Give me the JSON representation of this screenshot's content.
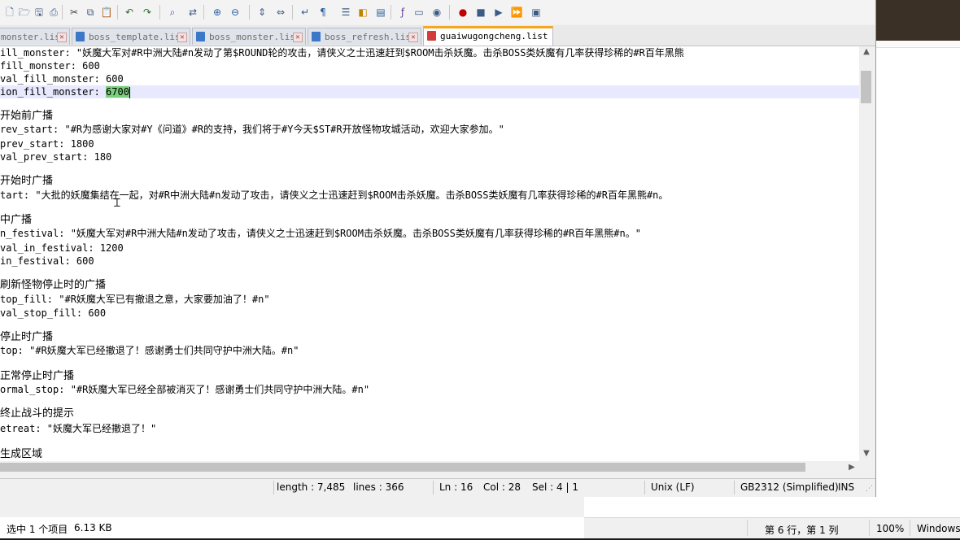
{
  "toolbar": {
    "icons": [
      "new-file-icon",
      "open-file-icon",
      "save-icon",
      "print-icon",
      "cut-icon",
      "copy-icon",
      "paste-icon",
      "undo-icon",
      "redo-icon",
      "find-icon",
      "replace-icon",
      "zoom-in-icon",
      "zoom-out-icon",
      "sync-vertical-icon",
      "sync-horizontal-icon",
      "word-wrap-icon",
      "show-all-chars-icon",
      "indent-guide-icon",
      "user-lang-icon",
      "doc-map-icon",
      "function-list-icon",
      "folder-workspace-icon",
      "monitor-icon",
      "record-macro-icon",
      "stop-macro-icon",
      "play-macro-icon",
      "run-macro-multiple-icon",
      "save-macro-icon"
    ]
  },
  "tabs": [
    {
      "label": "monster.list",
      "active": false
    },
    {
      "label": "boss_template.list",
      "active": false
    },
    {
      "label": "boss_monster.list",
      "active": false
    },
    {
      "label": "boss_refresh.list",
      "active": false
    },
    {
      "label": "guaiwugongcheng.list",
      "active": true
    }
  ],
  "editor": {
    "lines": [
      "ill_monster: \"妖魔大军对#R中洲大陆#n发动了第$ROUND轮的攻击，请侠义之士迅速赶到$ROOM击杀妖魔。击杀BOSS类妖魔有几率获得珍稀的#R百年黑熊",
      "fill_monster: 600",
      "val_fill_monster: 600",
      "ion_fill_monster: ",
      "",
      "开始前广播",
      "rev_start: \"#R为感谢大家对#Y《问道》#R的支持，我们将于#Y今天$ST#R开放怪物攻城活动，欢迎大家参加。\"",
      "prev_start: 1800",
      "val_prev_start: 180",
      "",
      "开始时广播",
      "tart: \"大批的妖魔集结在一起，对#R中洲大陆#n发动了攻击，请侠义之士迅速赶到$ROOM击杀妖魔。击杀BOSS类妖魔有几率获得珍稀的#R百年黑熊#n。",
      "",
      "中广播",
      "n_festival: \"妖魔大军对#R中洲大陆#n发动了攻击，请侠义之士迅速赶到$ROOM击杀妖魔。击杀BOSS类妖魔有几率获得珍稀的#R百年黑熊#n。\"",
      "val_in_festival: 1200",
      "in_festival: 600",
      "",
      "刷新怪物停止时的广播",
      "top_fill: \"#R妖魔大军已有撤退之意，大家要加油了！#n\"",
      "val_stop_fill: 600",
      "",
      "停止时广播",
      "top: \"#R妖魔大军已经撤退了！感谢勇士们共同守护中洲大陆。#n\"",
      "",
      "正常停止时广播",
      "ormal_stop: \"#R妖魔大军已经全部被消灭了！感谢勇士们共同守护中洲大陆。#n\"",
      "",
      "终止战斗的提示",
      "etreat: \"妖魔大军已经撤退了！\"",
      "",
      "生成区域"
    ],
    "selected_text": "6700"
  },
  "statusbar": {
    "length": "length : 7,485",
    "lines": "lines : 366",
    "ln": "Ln : 16",
    "col": "Col : 28",
    "sel": "Sel : 4 | 1",
    "eol": "Unix (LF)",
    "encoding": "GB2312 (Simplified)",
    "mode": "INS"
  },
  "explorer_status": {
    "selected": "选中 1 个项目",
    "size": "6.13 KB"
  },
  "notepad_status": {
    "position": "第 6 行，第 1 列",
    "zoom": "100%",
    "eol": "Windows"
  },
  "colors": {
    "active_tab_accent": "#f5a623",
    "selection": "#7ad07a",
    "current_line": "#e8e8ff"
  }
}
